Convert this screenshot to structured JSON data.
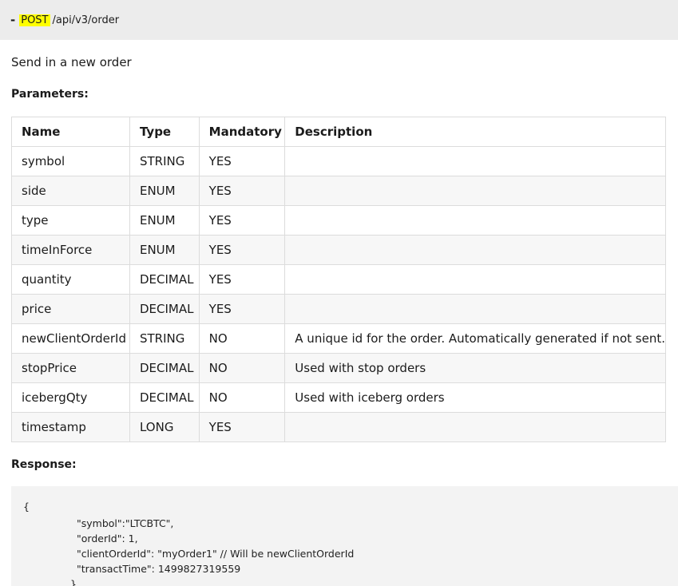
{
  "endpoint": {
    "dash": "-",
    "method": "POST",
    "path": "/api/v3/order"
  },
  "summary": "Send in a new order",
  "parameters_heading": "Parameters:",
  "parameters": {
    "columns": [
      "Name",
      "Type",
      "Mandatory",
      "Description"
    ],
    "rows": [
      {
        "name": "symbol",
        "type": "STRING",
        "mandatory": "YES",
        "description": ""
      },
      {
        "name": "side",
        "type": "ENUM",
        "mandatory": "YES",
        "description": ""
      },
      {
        "name": "type",
        "type": "ENUM",
        "mandatory": "YES",
        "description": ""
      },
      {
        "name": "timeInForce",
        "type": "ENUM",
        "mandatory": "YES",
        "description": ""
      },
      {
        "name": "quantity",
        "type": "DECIMAL",
        "mandatory": "YES",
        "description": ""
      },
      {
        "name": "price",
        "type": "DECIMAL",
        "mandatory": "YES",
        "description": ""
      },
      {
        "name": "newClientOrderId",
        "type": "STRING",
        "mandatory": "NO",
        "description": "A unique id for the order. Automatically generated if not sent."
      },
      {
        "name": "stopPrice",
        "type": "DECIMAL",
        "mandatory": "NO",
        "description": "Used with stop orders"
      },
      {
        "name": "icebergQty",
        "type": "DECIMAL",
        "mandatory": "NO",
        "description": "Used with iceberg orders"
      },
      {
        "name": "timestamp",
        "type": "LONG",
        "mandatory": "YES",
        "description": ""
      }
    ]
  },
  "response_heading": "Response:",
  "response_code": [
    "{",
    "\"symbol\":\"LTCBTC\",",
    "\"orderId\": 1,",
    "\"clientOrderId\": \"myOrder1\" // Will be newClientOrderId",
    "\"transactTime\": 1499827319559",
    "}"
  ]
}
